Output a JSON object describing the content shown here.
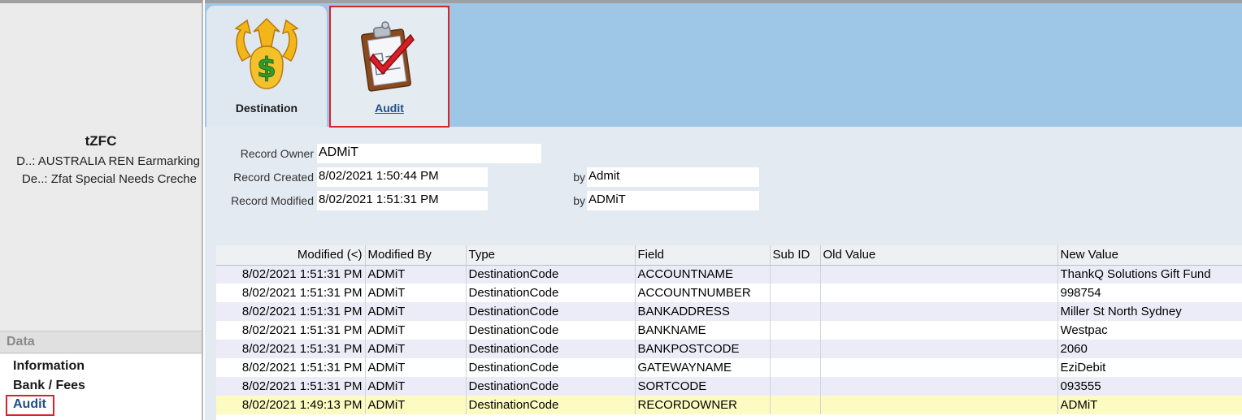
{
  "record": {
    "title": "tZFC",
    "line1": "D..: AUSTRALIA REN Earmarking",
    "line2": "De..: Zfat Special Needs Creche"
  },
  "nav": {
    "section": "Data",
    "items": [
      {
        "label": "Information"
      },
      {
        "label": "Bank / Fees"
      },
      {
        "label": "Audit"
      }
    ]
  },
  "tabs": {
    "destination": {
      "label": "Destination",
      "icon": "money-bag-arrows-icon"
    },
    "audit": {
      "label": "Audit",
      "icon": "clipboard-check-icon"
    }
  },
  "form": {
    "owner_label": "Record Owner",
    "owner_value": "ADMiT",
    "created_label": "Record Created",
    "created_value": "8/02/2021 1:50:44 PM",
    "created_by_label": "by",
    "created_by_value": "Admit",
    "modified_label": "Record Modified",
    "modified_value": "8/02/2021 1:51:31 PM",
    "modified_by_label": "by",
    "modified_by_value": "ADMiT"
  },
  "table": {
    "headers": [
      "Modified (<)",
      "Modified By",
      "Type",
      "Field",
      "Sub ID",
      "Old Value",
      "New Value"
    ],
    "rows": [
      [
        "8/02/2021 1:51:31 PM",
        "ADMiT",
        "DestinationCode",
        "ACCOUNTNAME",
        "",
        "",
        "ThankQ Solutions Gift Fund"
      ],
      [
        "8/02/2021 1:51:31 PM",
        "ADMiT",
        "DestinationCode",
        "ACCOUNTNUMBER",
        "",
        "",
        "998754"
      ],
      [
        "8/02/2021 1:51:31 PM",
        "ADMiT",
        "DestinationCode",
        "BANKADDRESS",
        "",
        "",
        "Miller St North Sydney"
      ],
      [
        "8/02/2021 1:51:31 PM",
        "ADMiT",
        "DestinationCode",
        "BANKNAME",
        "",
        "",
        "Westpac"
      ],
      [
        "8/02/2021 1:51:31 PM",
        "ADMiT",
        "DestinationCode",
        "BANKPOSTCODE",
        "",
        "",
        "2060"
      ],
      [
        "8/02/2021 1:51:31 PM",
        "ADMiT",
        "DestinationCode",
        "GATEWAYNAME",
        "",
        "",
        "EziDebit"
      ],
      [
        "8/02/2021 1:51:31 PM",
        "ADMiT",
        "DestinationCode",
        "SORTCODE",
        "",
        "",
        "093555"
      ],
      [
        "8/02/2021 1:49:13 PM",
        "ADMiT",
        "DestinationCode",
        "RECORDOWNER",
        "",
        "",
        "ADMiT"
      ]
    ]
  },
  "colors": {
    "ribbon": "#9ec6e6",
    "highlight_row": "#fdfbc1",
    "alt_row": "#ececf8",
    "selection_box": "#d8232a",
    "active_link": "#1f4e8c"
  }
}
